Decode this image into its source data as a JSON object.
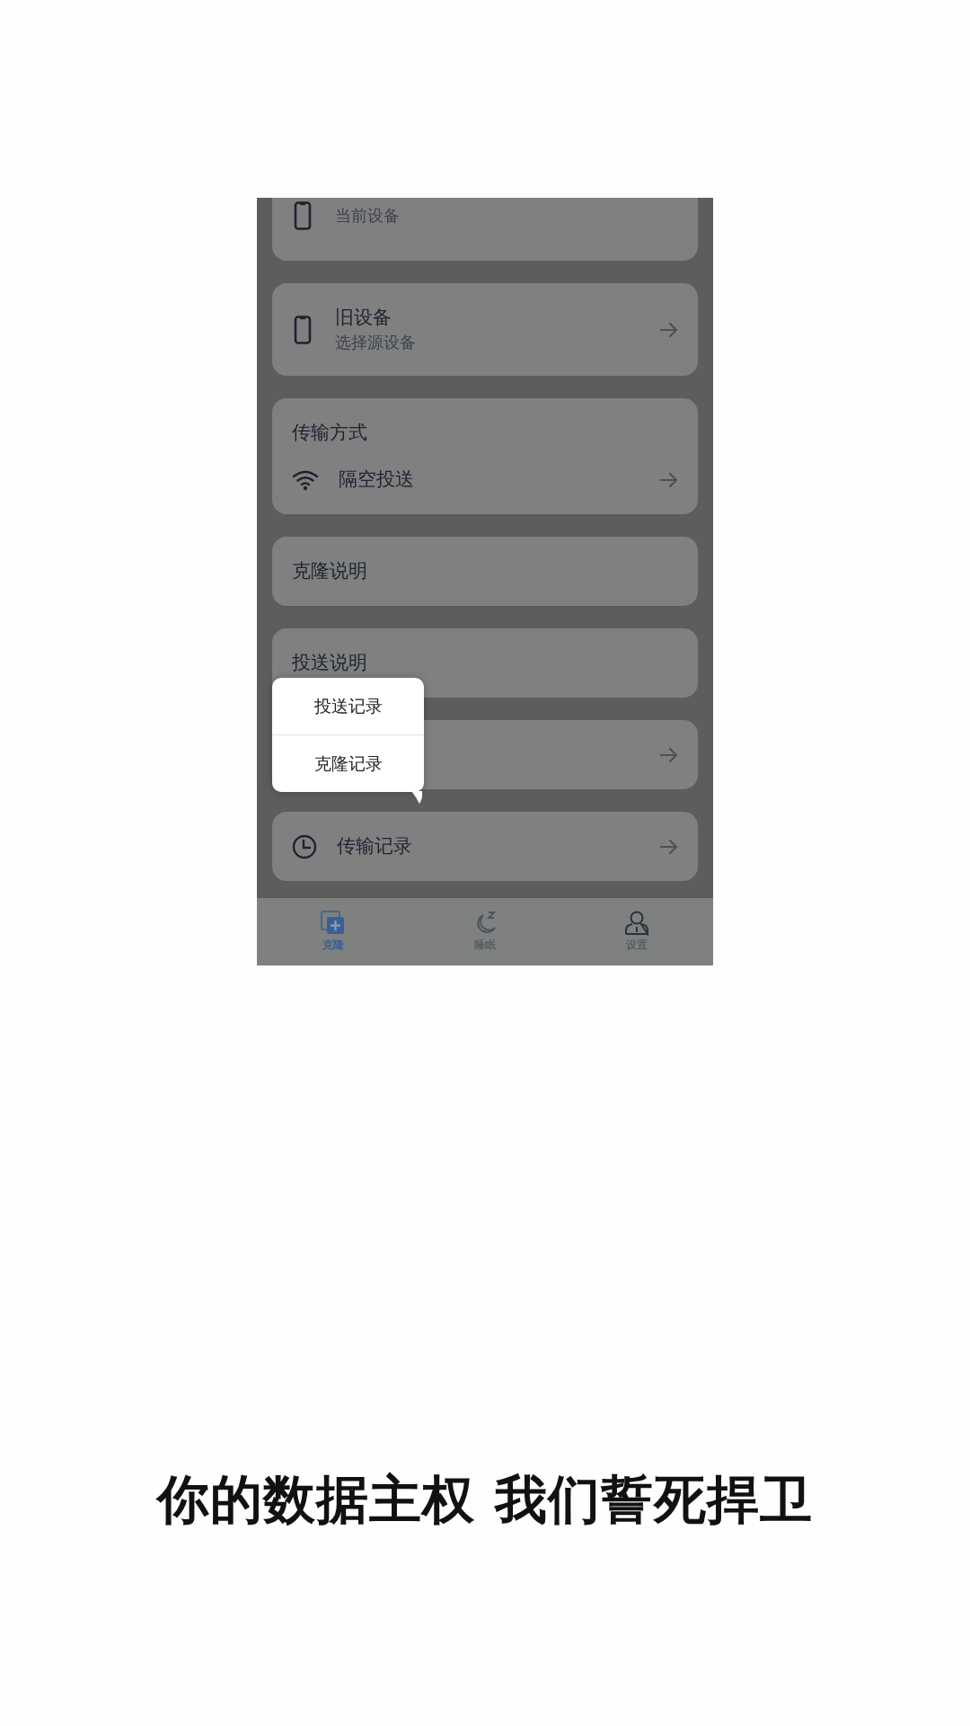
{
  "screen": {
    "cards": [
      {
        "kind": "device",
        "subtitle": "当前设备",
        "arrow": false
      },
      {
        "kind": "device",
        "title": "旧设备",
        "subtitle": "选择源设备",
        "arrow": true
      },
      {
        "kind": "method",
        "title": "传输方式",
        "option": "隔空投送",
        "arrow": true
      },
      {
        "kind": "plain",
        "title": "克隆说明",
        "arrow": false
      },
      {
        "kind": "plain",
        "title": "投送说明",
        "arrow": false
      },
      {
        "kind": "covered",
        "arrow": true
      },
      {
        "kind": "history",
        "title": "传输记录",
        "arrow": true
      }
    ],
    "popup_menu": [
      "投送记录",
      "克隆记录"
    ],
    "tabs": [
      {
        "kind": "clone",
        "label": "克隆",
        "selected": true
      },
      {
        "kind": "sleep",
        "label": "睡眠",
        "selected": false
      },
      {
        "kind": "profile",
        "label": "设置",
        "selected": false
      }
    ]
  },
  "tagline": "你的数据主权 我们誓死捍卫"
}
